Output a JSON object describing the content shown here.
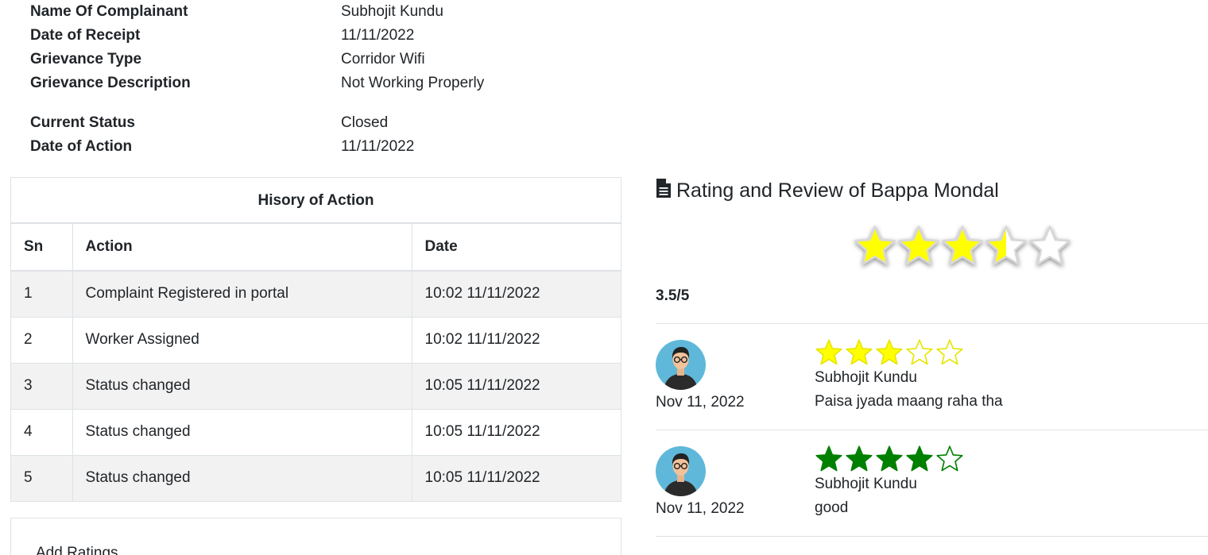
{
  "complaint": {
    "rows": [
      {
        "label": "Name Of Complainant",
        "value": "Subhojit Kundu"
      },
      {
        "label": "Date of Receipt",
        "value": "11/11/2022"
      },
      {
        "label": "Grievance Type",
        "value": "Corridor Wifi"
      },
      {
        "label": "Grievance Description",
        "value": "Not Working Properly"
      },
      {
        "label": "Current Status",
        "value": "Closed"
      },
      {
        "label": "Date of Action",
        "value": "11/11/2022"
      }
    ]
  },
  "history": {
    "title": "Hisory of Action",
    "columns": [
      "Sn",
      "Action",
      "Date"
    ],
    "rows": [
      {
        "sn": "1",
        "action": "Complaint Registered in portal",
        "date": "10:02 11/11/2022"
      },
      {
        "sn": "2",
        "action": "Worker Assigned",
        "date": "10:02 11/11/2022"
      },
      {
        "sn": "3",
        "action": "Status changed",
        "date": "10:05 11/11/2022"
      },
      {
        "sn": "4",
        "action": "Status changed",
        "date": "10:05 11/11/2022"
      },
      {
        "sn": "5",
        "action": "Status changed",
        "date": "10:05 11/11/2022"
      }
    ]
  },
  "add_ratings": {
    "label": "Add Ratings"
  },
  "rating": {
    "title": "Rating and Review of Bappa Mondal",
    "icon": "file-text-icon",
    "score": 3.5,
    "score_text": "3.5/5",
    "star_color": "#ffff00",
    "reviews": [
      {
        "name": "Subhojit Kundu",
        "date": "Nov 11, 2022",
        "text": "Paisa jyada maang raha tha",
        "stars": 3,
        "color": "#ffff00",
        "outline": "#e6e600"
      },
      {
        "name": "Subhojit Kundu",
        "date": "Nov 11, 2022",
        "text": "good",
        "stars": 4,
        "color": "#008000",
        "outline": "#008000"
      }
    ]
  }
}
